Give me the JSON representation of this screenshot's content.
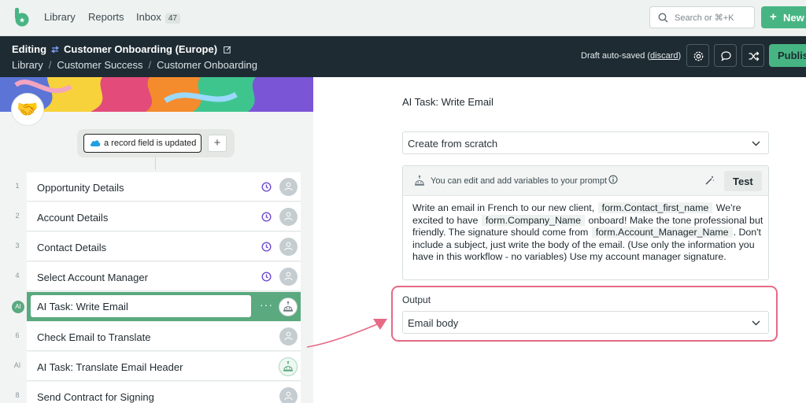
{
  "topnav": {
    "links": [
      "Library",
      "Reports",
      "Inbox"
    ],
    "inbox_count": "47",
    "search_placeholder": "Search or ⌘+K",
    "new_label": "New"
  },
  "header": {
    "editing_label": "Editing",
    "workflow_name": "Customer Onboarding (Europe)",
    "breadcrumb": [
      "Library",
      "Customer Success",
      "Customer Onboarding"
    ],
    "autosave_text": "Draft auto-saved (",
    "discard_label": "discard",
    "autosave_close": ")",
    "publish_label": "Publis"
  },
  "left": {
    "trigger_label": "a record field is updated",
    "add_label": "+",
    "steps": [
      {
        "num": "1",
        "label": "Opportunity Details"
      },
      {
        "num": "2",
        "label": "Account Details"
      },
      {
        "num": "3",
        "label": "Contact Details"
      },
      {
        "num": "4",
        "label": "Select Account Manager"
      },
      {
        "num": "AI",
        "label": "AI Task: Write Email"
      },
      {
        "num": "6",
        "label": "Check Email to Translate"
      },
      {
        "num": "AI",
        "label": "AI Task: Translate Email Header"
      },
      {
        "num": "8",
        "label": "Send Contract for Signing"
      }
    ],
    "active_dots": "···"
  },
  "right": {
    "title": "AI Task: Write Email",
    "mode_select": "Create from scratch",
    "prompt_hint": "You can edit and add variables to your prompt",
    "test_label": "Test",
    "prompt": {
      "t1": "Write an email in French to our new client,",
      "v1": "form.Contact_first_name",
      "t2": "We're excited to have",
      "v2": "form.Company_Name",
      "t3": "onboard! Make the tone professional but friendly. The signature should come from",
      "v3": "form.Account_Manager_Name",
      "t4": ". Don't include a subject, just write the body of the email. (Use only the information you have in this workflow - no variables) Use my account manager signature."
    },
    "output_label": "Output",
    "output_select": "Email body"
  },
  "colors": {
    "brand_green": "#47b583",
    "active_step": "#5aa97f",
    "dark_header": "#1e2b33",
    "highlight": "#e66a86",
    "clock_purple": "#6f4bd1"
  },
  "icons": [
    "logo-icon",
    "search-icon",
    "flow-icon",
    "pencil-icon",
    "gear-icon",
    "chat-icon",
    "shuffle-icon",
    "salesforce-icon",
    "clock-icon",
    "user-icon",
    "robot-icon",
    "info-icon",
    "wand-icon",
    "chevron-down-icon"
  ]
}
